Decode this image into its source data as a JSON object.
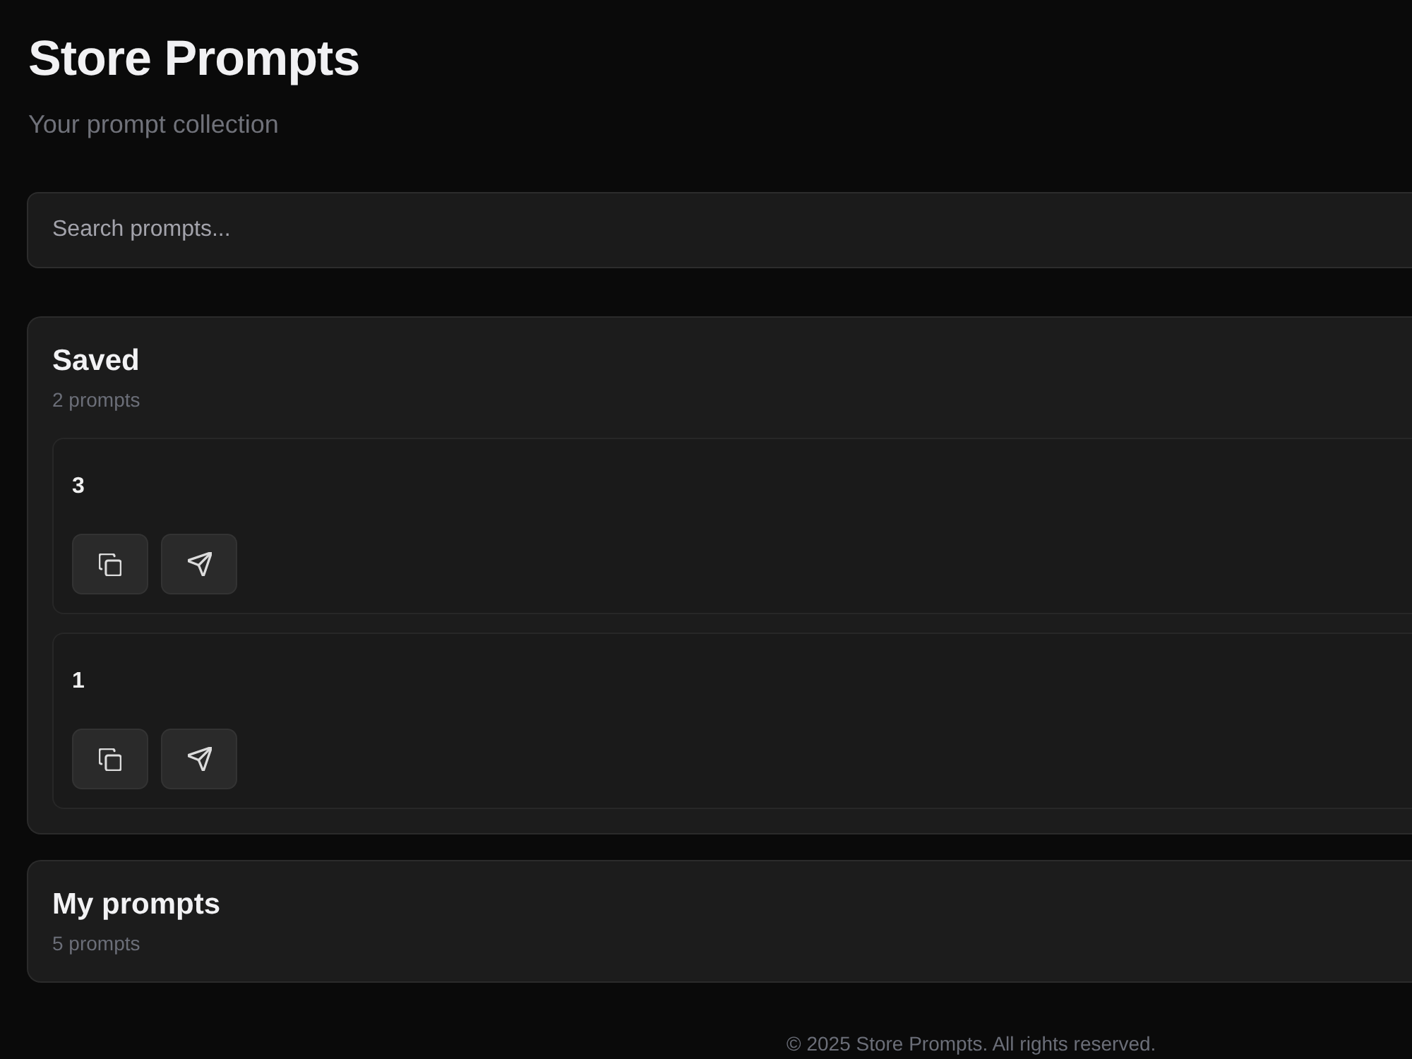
{
  "header": {
    "title": "Store Prompts",
    "subtitle": "Your prompt collection"
  },
  "search": {
    "placeholder": "Search prompts..."
  },
  "sections": [
    {
      "title": "Saved",
      "count": "2 prompts",
      "prompts": [
        {
          "text": "3",
          "actions": [
            {
              "kind": "copy"
            },
            {
              "kind": "send"
            }
          ]
        },
        {
          "text": "1",
          "actions": [
            {
              "kind": "copy"
            },
            {
              "kind": "send"
            }
          ]
        }
      ]
    },
    {
      "title": "My prompts",
      "count": "5 prompts"
    }
  ],
  "footer": {
    "text": "© 2025 Store Prompts. All rights reserved."
  }
}
